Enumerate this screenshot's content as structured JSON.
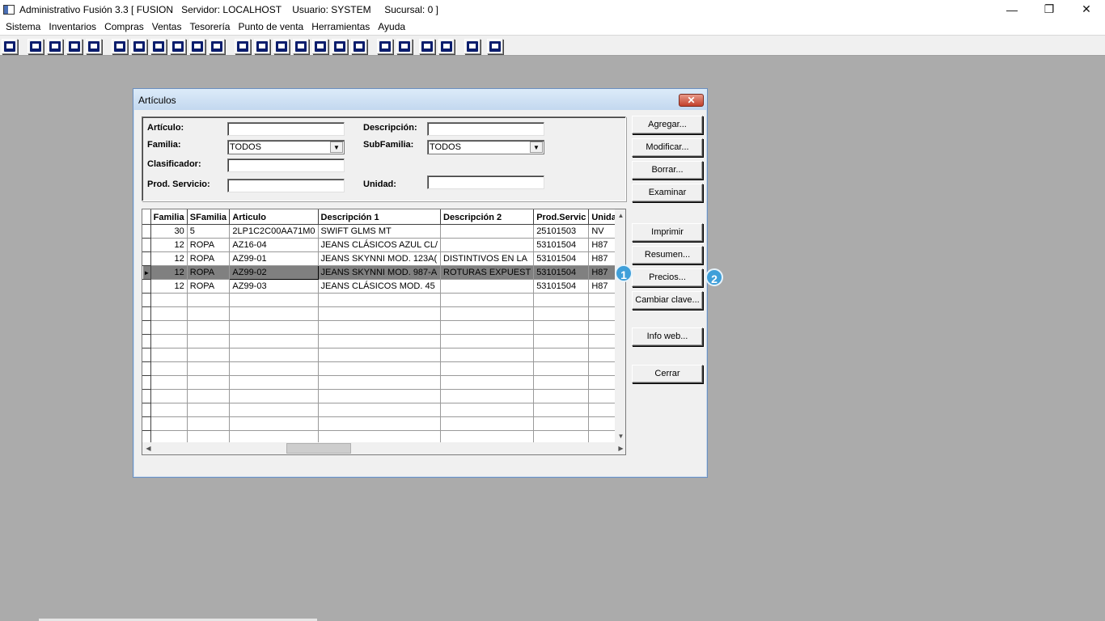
{
  "window": {
    "title": "Administrativo Fusión 3.3 [ FUSION   Servidor: LOCALHOST    Usuario: SYSTEM     Sucursal: 0 ]",
    "minimize": "—",
    "restore": "❐",
    "close": "✕"
  },
  "menu": [
    "Sistema",
    "Inventarios",
    "Compras",
    "Ventas",
    "Tesorería",
    "Punto de venta",
    "Herramientas",
    "Ayuda"
  ],
  "dialog": {
    "title": "Artículos",
    "close": "✕",
    "filters": {
      "articulo_label": "Artículo:",
      "descripcion_label": "Descripción:",
      "familia_label": "Familia:",
      "familia_value": "TODOS",
      "subfamilia_label": "SubFamilia:",
      "subfamilia_value": "TODOS",
      "clasificador_label": "Clasificador:",
      "prod_servicio_label": "Prod. Servicio:",
      "unidad_label": "Unidad:"
    },
    "grid": {
      "columns": [
        "Familia",
        "SFamilia",
        "Articulo",
        "Descripción 1",
        "Descripción 2",
        "Prod.Servic",
        "Unidad"
      ],
      "rows": [
        [
          "30",
          "5",
          "2LP1C2C00AA71M0",
          "SWIFT GLMS MT",
          "",
          "25101503",
          "NV"
        ],
        [
          "12",
          "ROPA",
          "AZ16-04",
          "JEANS CLÁSICOS AZUL CL/",
          "",
          "53101504",
          "H87"
        ],
        [
          "12",
          "ROPA",
          "AZ99-01",
          "JEANS SKYNNI MOD. 123A(",
          "DISTINTIVOS EN LA",
          "53101504",
          "H87"
        ],
        [
          "12",
          "ROPA",
          "AZ99-02",
          "JEANS SKYNNI MOD. 987-A",
          "ROTURAS EXPUEST",
          "53101504",
          "H87"
        ],
        [
          "12",
          "ROPA",
          "AZ99-03",
          "JEANS CLÁSICOS MOD. 45",
          "",
          "53101504",
          "H87"
        ]
      ],
      "selected_indicator": "►"
    },
    "buttons": {
      "agregar": "Agregar...",
      "modificar": "Modificar...",
      "borrar": "Borrar...",
      "examinar": "Examinar",
      "imprimir": "Imprimir",
      "resumen": "Resumen...",
      "precios": "Precios...",
      "cambiar_clave": "Cambiar clave...",
      "info_web": "Info web...",
      "cerrar": "Cerrar"
    }
  },
  "badges": {
    "one": "1",
    "two": "2"
  },
  "colors": {
    "desktop": "#ababab",
    "selected_row": "#808080",
    "badge": "#3f9fd9"
  }
}
